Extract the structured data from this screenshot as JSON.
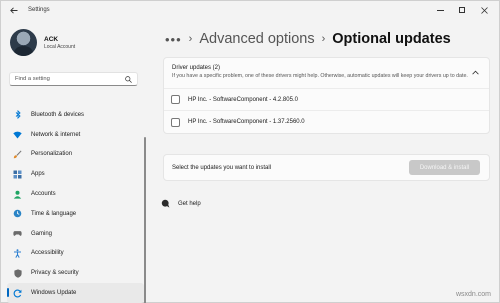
{
  "window": {
    "title": "Settings"
  },
  "profile": {
    "name": "ACK",
    "account_type": "Local Account"
  },
  "search": {
    "placeholder": "Find a setting"
  },
  "sidebar": {
    "items": [
      {
        "label": "Bluetooth & devices",
        "icon": "bluetooth-icon",
        "color": "#0078d4"
      },
      {
        "label": "Network & internet",
        "icon": "wifi-icon",
        "color": "#0078d4"
      },
      {
        "label": "Personalization",
        "icon": "brush-icon",
        "color": "#c46f1d"
      },
      {
        "label": "Apps",
        "icon": "apps-icon",
        "color": "#3a6ea5"
      },
      {
        "label": "Accounts",
        "icon": "person-icon",
        "color": "#1fa463"
      },
      {
        "label": "Time & language",
        "icon": "globe-clock-icon",
        "color": "#2a84c6"
      },
      {
        "label": "Gaming",
        "icon": "gamepad-icon",
        "color": "#6b6b6b"
      },
      {
        "label": "Accessibility",
        "icon": "accessibility-icon",
        "color": "#2c7fd1"
      },
      {
        "label": "Privacy & security",
        "icon": "shield-icon",
        "color": "#6b6b6b"
      },
      {
        "label": "Windows Update",
        "icon": "update-icon",
        "color": "#0078d4",
        "active": true
      }
    ]
  },
  "breadcrumb": {
    "more": "•••",
    "parent": "Advanced options",
    "current": "Optional updates"
  },
  "driver_updates": {
    "title": "Driver updates (2)",
    "description": "If you have a specific problem, one of these drivers might help. Otherwise, automatic updates will keep your drivers up to date.",
    "items": [
      {
        "label": "HP Inc. - SoftwareComponent - 4.2.805.0",
        "checked": false
      },
      {
        "label": "HP Inc. - SoftwareComponent - 1.37.2560.0",
        "checked": false
      }
    ]
  },
  "install": {
    "text": "Select the updates you want to install",
    "button_label": "Download & install"
  },
  "help": {
    "label": "Get help"
  },
  "watermark": "wsxdn.com"
}
